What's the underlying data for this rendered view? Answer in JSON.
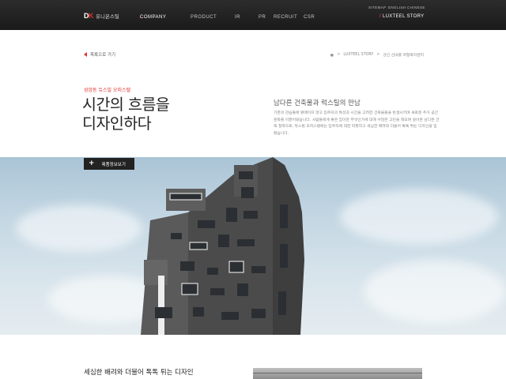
{
  "brand": {
    "mark_d": "D",
    "mark_k": "K",
    "name": "유니온스틸"
  },
  "nav": {
    "items": [
      {
        "label": "COMPANY",
        "active": true
      },
      {
        "label": "PRODUCT",
        "active": false
      },
      {
        "label": "IR",
        "active": false
      },
      {
        "label": "PR",
        "active": false
      },
      {
        "label": "RECRUIT",
        "active": false
      },
      {
        "label": "CSR",
        "active": false
      }
    ],
    "story_label": "LUXTEEL STORY"
  },
  "utility": {
    "sitemap": "SITEMAP",
    "english": "ENGLISH",
    "chinese": "CHINESE"
  },
  "subnav": {
    "back_label": "목록으로 가기",
    "breadcrumb": [
      "LUXTEEL STORY",
      "강인 선내를 여형복지센터"
    ]
  },
  "hero": {
    "kicker": "성암동 듀스빌 오피스텔",
    "headline_line1": "시간의 흐름을",
    "headline_line2": "디자인하다",
    "subtitle": "남다른 건축물과 럭스틸의 만남",
    "description": "기존의 관습들에 얽매이지 않고 입주자의 특성과 시간을 고려한 건축물들을 탄생시키며 새로운 주거 공간 문화를 이끌어왔습니다. 사람들에게 좋은 집이란 무엇인가에 대해 수많은 고민을 해오며 살아온 남다른 건축 철학으로, 듀스빌 오피스텔에는 입주자에 대한 따뜻하고 세심한 배려와 더불어 톡톡 튀는 디자인을 입혔습니다."
  },
  "actions": {
    "product_info": "제품정보보기"
  },
  "section": {
    "title": "세심한 배려와 더불어 톡톡 튀는 디자인"
  },
  "colors": {
    "accent": "#e0322d",
    "header_bg": "#222222"
  }
}
